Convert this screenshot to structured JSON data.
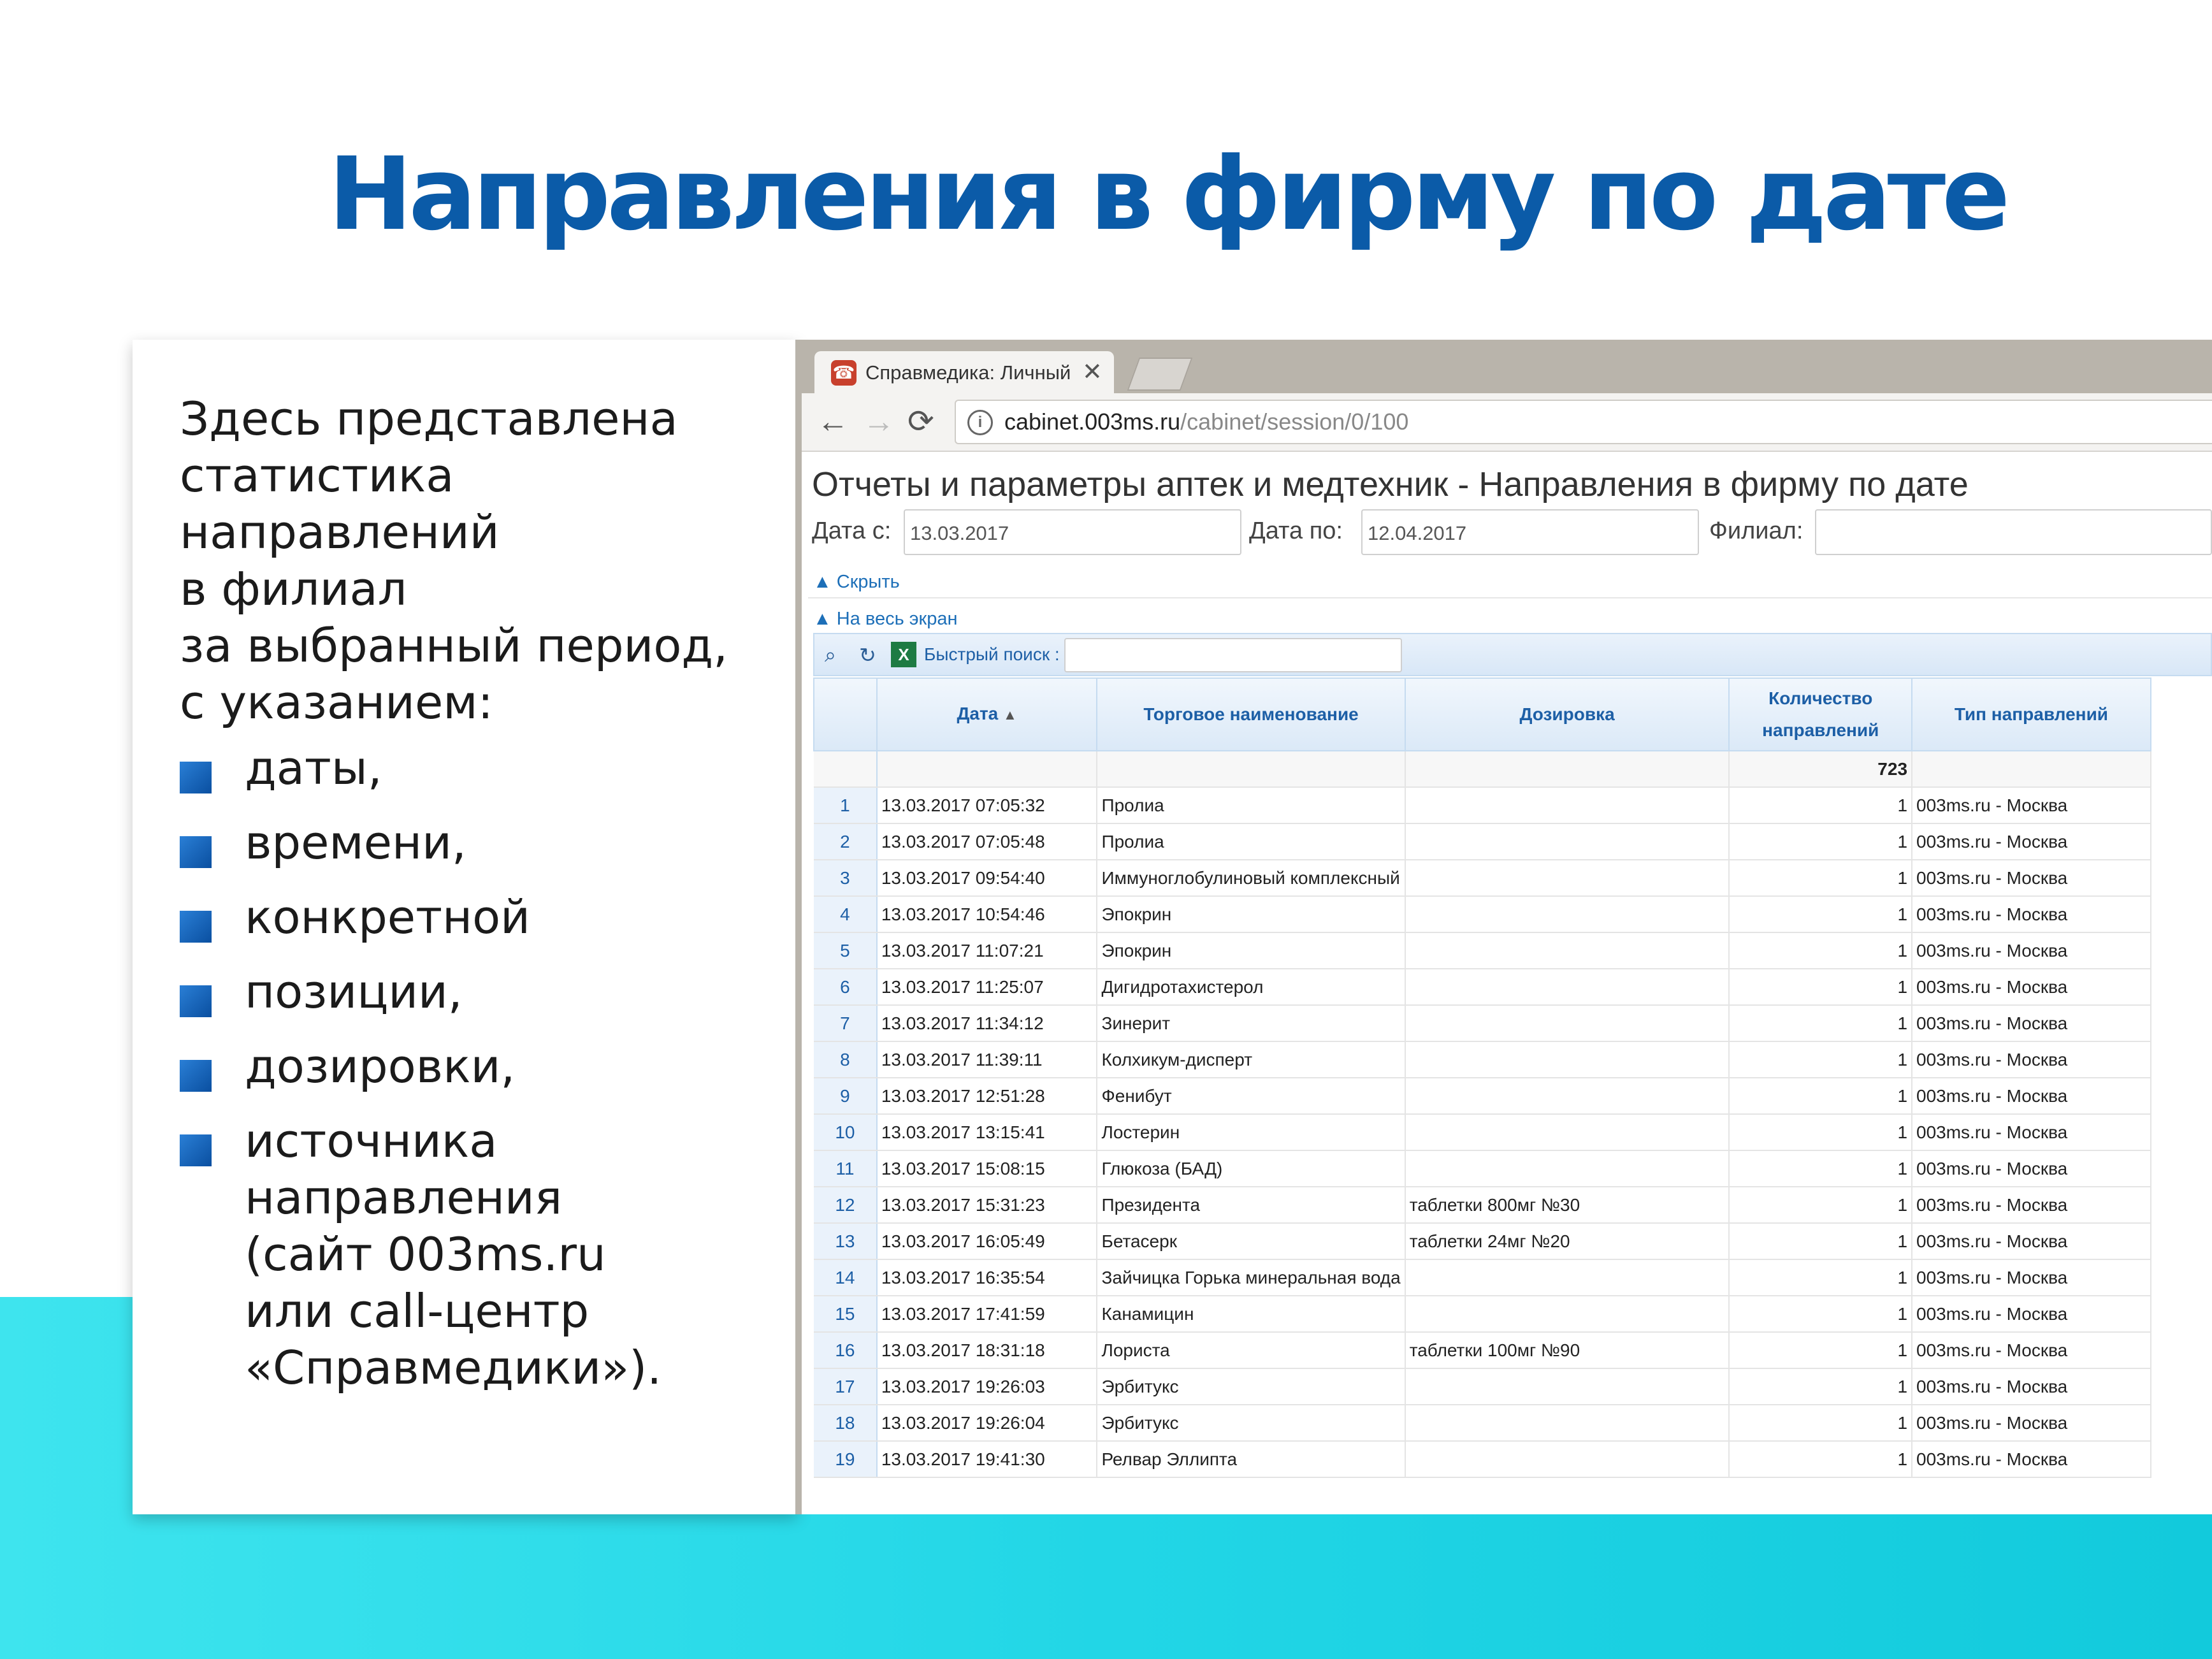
{
  "slide": {
    "title": "Направления в фирму по дате",
    "intro": "Здесь представлена\nстатистика\nнаправлений\nв филиал\nза выбранный период,\nс указанием:",
    "bullets": [
      "даты,",
      "времени,",
      "конкретной",
      "позиции,",
      "дозировки,",
      "источника\nнаправления\n(сайт 003ms.ru\nили call-центр\n«Справмедики»)."
    ]
  },
  "browser": {
    "tab_title": "Справмедика: Личный к",
    "tab_close": "✕",
    "url_host": "cabinet.003ms.ru",
    "url_path": "/cabinet/session/0/100",
    "icons": [
      "back-icon",
      "forward-icon",
      "reload-icon",
      "info-icon"
    ]
  },
  "page": {
    "title": "Отчеты и параметры аптек и медтехник - Направления в фирму по дате",
    "date_from_label": "Дата с:",
    "date_from_value": "13.03.2017",
    "date_to_label": "Дата по:",
    "date_to_value": "12.04.2017",
    "branch_label": "Филиал:",
    "branch_value": "",
    "hide_link": "▲ Скрыть",
    "fullscreen_link": "▲ На весь экран",
    "quick_search_label": "Быстрый поиск :",
    "quick_search_value": ""
  },
  "table": {
    "columns": [
      "",
      "Дата",
      "Торговое наименование",
      "Дозировка",
      "Количество направлений",
      "Тип направлений"
    ],
    "total": "723",
    "rows": [
      [
        "1",
        "13.03.2017 07:05:32",
        "Пролиа",
        "",
        "1",
        "003ms.ru - Москва"
      ],
      [
        "2",
        "13.03.2017 07:05:48",
        "Пролиа",
        "",
        "1",
        "003ms.ru - Москва"
      ],
      [
        "3",
        "13.03.2017 09:54:40",
        "Иммуноглобулиновый комплексный",
        "",
        "1",
        "003ms.ru - Москва"
      ],
      [
        "4",
        "13.03.2017 10:54:46",
        "Эпокрин",
        "",
        "1",
        "003ms.ru - Москва"
      ],
      [
        "5",
        "13.03.2017 11:07:21",
        "Эпокрин",
        "",
        "1",
        "003ms.ru - Москва"
      ],
      [
        "6",
        "13.03.2017 11:25:07",
        "Дигидротахистерол",
        "",
        "1",
        "003ms.ru - Москва"
      ],
      [
        "7",
        "13.03.2017 11:34:12",
        "Зинерит",
        "",
        "1",
        "003ms.ru - Москва"
      ],
      [
        "8",
        "13.03.2017 11:39:11",
        "Колхикум-дисперт",
        "",
        "1",
        "003ms.ru - Москва"
      ],
      [
        "9",
        "13.03.2017 12:51:28",
        "Фенибут",
        "",
        "1",
        "003ms.ru - Москва"
      ],
      [
        "10",
        "13.03.2017 13:15:41",
        "Лостерин",
        "",
        "1",
        "003ms.ru - Москва"
      ],
      [
        "11",
        "13.03.2017 15:08:15",
        "Глюкоза (БАД)",
        "",
        "1",
        "003ms.ru - Москва"
      ],
      [
        "12",
        "13.03.2017 15:31:23",
        "Президента",
        "таблетки 800мг №30",
        "1",
        "003ms.ru - Москва"
      ],
      [
        "13",
        "13.03.2017 16:05:49",
        "Бетасерк",
        "таблетки 24мг №20",
        "1",
        "003ms.ru - Москва"
      ],
      [
        "14",
        "13.03.2017 16:35:54",
        "Зайчицка Горька минеральная вода",
        "",
        "1",
        "003ms.ru - Москва"
      ],
      [
        "15",
        "13.03.2017 17:41:59",
        "Канамицин",
        "",
        "1",
        "003ms.ru - Москва"
      ],
      [
        "16",
        "13.03.2017 18:31:18",
        "Лориста",
        "таблетки 100мг №90",
        "1",
        "003ms.ru - Москва"
      ],
      [
        "17",
        "13.03.2017 19:26:03",
        "Эрбитукс",
        "",
        "1",
        "003ms.ru - Москва"
      ],
      [
        "18",
        "13.03.2017 19:26:04",
        "Эрбитукс",
        "",
        "1",
        "003ms.ru - Москва"
      ],
      [
        "19",
        "13.03.2017 19:41:30",
        "Релвар Эллипта",
        "",
        "1",
        "003ms.ru - Москва"
      ]
    ]
  },
  "colors": {
    "title_blue": "#0b5ba8",
    "band_cyan": "#22d6e6",
    "grid_header_blue": "#1d5fa6"
  }
}
